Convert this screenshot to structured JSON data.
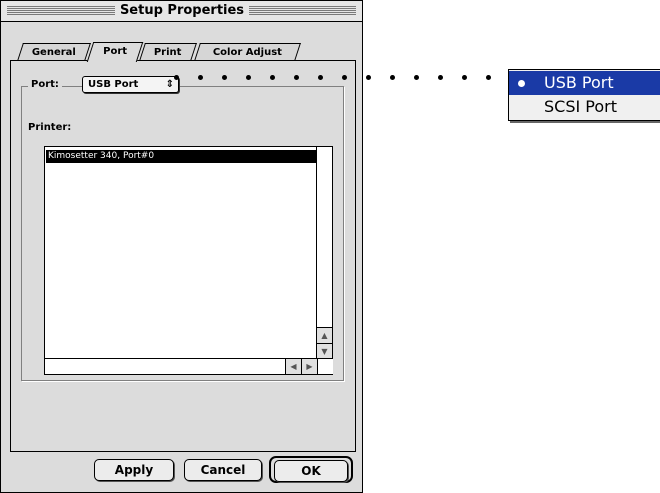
{
  "window": {
    "title": "Setup Properties"
  },
  "tabs": [
    {
      "label": "General"
    },
    {
      "label": "Port"
    },
    {
      "label": "Print"
    },
    {
      "label": "Color Adjust"
    }
  ],
  "port": {
    "label": "Port:",
    "selected": "USB Port",
    "arrows": "⇕"
  },
  "printer": {
    "label": "Printer:",
    "items": [
      "Kimosetter 340, Port#0"
    ]
  },
  "buttons": {
    "apply": "Apply",
    "cancel": "Cancel",
    "ok": "OK"
  },
  "port_menu": {
    "options": [
      "USB Port",
      "SCSI Port"
    ],
    "selected_index": 0
  },
  "colors": {
    "menu_highlight": "#1a3aa6",
    "window_bg": "#dcdcdc"
  }
}
